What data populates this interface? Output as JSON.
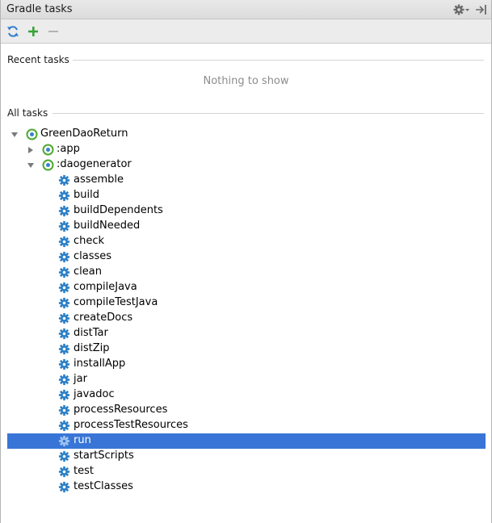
{
  "window": {
    "title": "Gradle tasks"
  },
  "toolbar": {
    "refresh": "refresh-icon",
    "add": "add-icon",
    "remove": "remove-icon"
  },
  "recent": {
    "label": "Recent tasks",
    "empty_text": "Nothing to show"
  },
  "all": {
    "label": "All tasks"
  },
  "tree": {
    "root": "GreenDaoReturn",
    "module_app": ":app",
    "module_daogenerator": ":daogenerator",
    "tasks": [
      "assemble",
      "build",
      "buildDependents",
      "buildNeeded",
      "check",
      "classes",
      "clean",
      "compileJava",
      "compileTestJava",
      "createDocs",
      "distTar",
      "distZip",
      "installApp",
      "jar",
      "javadoc",
      "processResources",
      "processTestResources",
      "run",
      "startScripts",
      "test",
      "testClasses"
    ],
    "selected_task": "run"
  },
  "colors": {
    "selection": "#3875d7",
    "task_icon": "#2b7fc6",
    "module_icon": "#4caa2e",
    "add_icon": "#3aa23a"
  }
}
